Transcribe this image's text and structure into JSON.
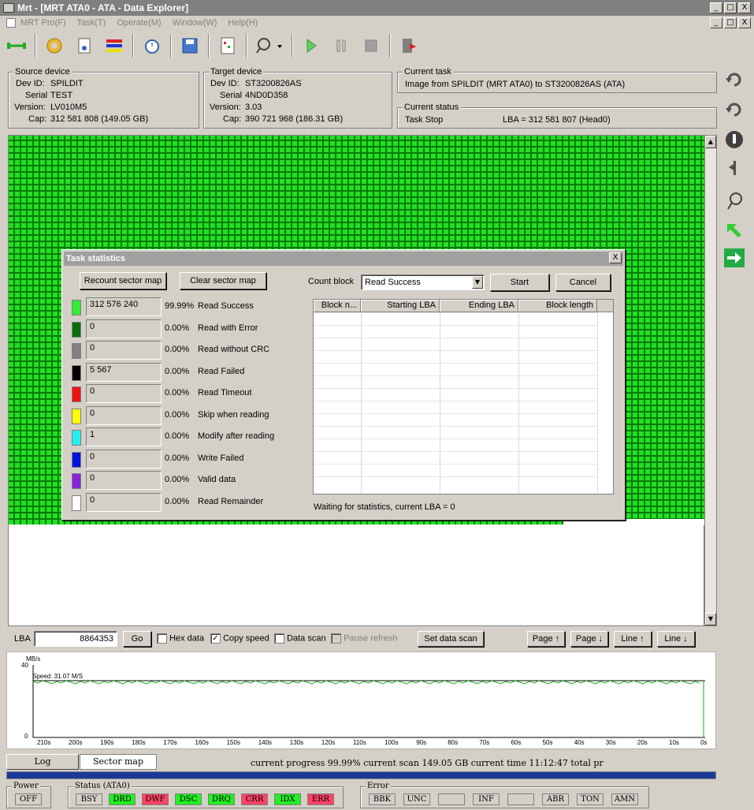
{
  "window": {
    "title": "Mrt - [MRT ATA0 - ATA - Data Explorer]",
    "min": "_",
    "max": "□",
    "close": "X"
  },
  "menu": {
    "items": [
      "MRT Pro(F)",
      "Task(T)",
      "Operate(M)",
      "Window(W)",
      "Help(H)"
    ]
  },
  "source": {
    "group": "Source device",
    "dev_label": "Dev ID:",
    "dev": "SPILDIT",
    "serial_label": "Serial",
    "serial": "TEST",
    "version_label": "Version:",
    "version": "LV010M5",
    "cap_label": "Cap:",
    "cap": "312 581 808 (149.05 GB)"
  },
  "target": {
    "group": "Target device",
    "dev_label": "Dev ID:",
    "dev": "ST3200826AS",
    "serial_label": "Serial",
    "serial": "4ND0D358",
    "version_label": "Version:",
    "version": "3.03",
    "cap_label": "Cap:",
    "cap": "390 721 968 (186.31 GB)"
  },
  "task": {
    "group": "Current task",
    "text": "Image from SPILDIT (MRT ATA0) to ST3200826AS (ATA)"
  },
  "status": {
    "group": "Current status",
    "text": "Task Stop",
    "lba": "LBA = 312 581 807 (Head0)"
  },
  "dialog": {
    "title": "Task statistics",
    "recount": "Recount sector map",
    "clear": "Clear sector map",
    "count_label": "Count block",
    "count_value": "Read Success",
    "start": "Start",
    "cancel": "Cancel",
    "stats": [
      {
        "color": "#33ee33",
        "value": "312 576 240",
        "pct": "99.99%",
        "label": "Read Success"
      },
      {
        "color": "#0a6e0a",
        "value": "0",
        "pct": "0.00%",
        "label": "Read with Error"
      },
      {
        "color": "#808080",
        "value": "0",
        "pct": "0.00%",
        "label": "Read without CRC"
      },
      {
        "color": "#000000",
        "value": "5 567",
        "pct": "0.00%",
        "label": "Read Failed"
      },
      {
        "color": "#ee1111",
        "value": "0",
        "pct": "0.00%",
        "label": "Read Timeout"
      },
      {
        "color": "#ffff00",
        "value": "0",
        "pct": "0.00%",
        "label": "Skip when reading"
      },
      {
        "color": "#22eeee",
        "value": "1",
        "pct": "0.00%",
        "label": "Modify after reading"
      },
      {
        "color": "#0011dd",
        "value": "0",
        "pct": "0.00%",
        "label": "Write Failed"
      },
      {
        "color": "#8822dd",
        "value": "0",
        "pct": "0.00%",
        "label": "Valid data"
      },
      {
        "color": "#ffffff",
        "value": "0",
        "pct": "0.00%",
        "label": "Read Remainder"
      }
    ],
    "columns": [
      "Block n...",
      "Starting LBA",
      "Ending LBA",
      "Block length"
    ],
    "waiting": "Waiting for statistics, current LBA = 0"
  },
  "lba_bar": {
    "label": "LBA",
    "value": "8864353",
    "go": "Go",
    "hex": "Hex data",
    "copy": "Copy speed",
    "scan": "Data scan",
    "pause": "Pause refresh",
    "set_scan": "Set data scan",
    "page_up": "Page ↑",
    "page_down": "Page ↓",
    "line_up": "Line ↑",
    "line_down": "Line ↓"
  },
  "speed": {
    "unit": "MB/s",
    "ymax": "40",
    "ymin": "0",
    "label": "Speed: 31.07 M/S",
    "ticks": [
      "210s",
      "200s",
      "190s",
      "180s",
      "170s",
      "160s",
      "150s",
      "140s",
      "130s",
      "120s",
      "110s",
      "100s",
      "90s",
      "80s",
      "70s",
      "60s",
      "50s",
      "40s",
      "30s",
      "20s",
      "10s",
      "0s"
    ]
  },
  "tabs": {
    "log": "Log",
    "sector": "Sector map"
  },
  "progress_text": "current progress 99.99% current scan  149.05 GB  current time  11:12:47  total pr",
  "power": {
    "label": "Power",
    "off": "OFF"
  },
  "status_ata": {
    "label": "Status (ATA0)",
    "items": [
      {
        "t": "BSY",
        "c": "#d4d0c8"
      },
      {
        "t": "DRD",
        "c": "#22ee22"
      },
      {
        "t": "DWF",
        "c": "#ff4466"
      },
      {
        "t": "DSC",
        "c": "#22ee22"
      },
      {
        "t": "DRQ",
        "c": "#22ee22"
      },
      {
        "t": "CRR",
        "c": "#ff4466"
      },
      {
        "t": "IDX",
        "c": "#22ee22"
      },
      {
        "t": "ERR",
        "c": "#ff4466"
      }
    ]
  },
  "error": {
    "label": "Error",
    "items": [
      "BBK",
      "UNC",
      "",
      "INF",
      "",
      "ABR",
      "TON",
      "AMN"
    ]
  }
}
